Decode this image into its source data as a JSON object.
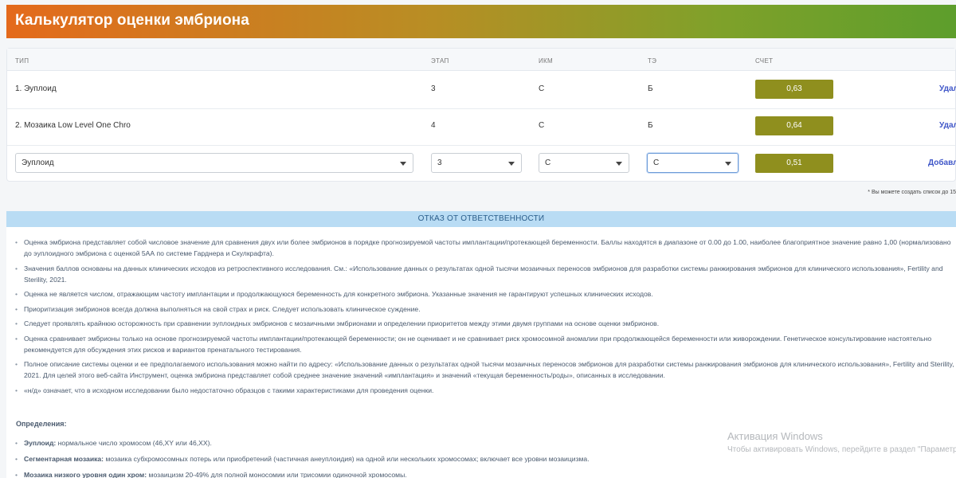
{
  "header": {
    "title": "Калькулятор оценки эмбриона"
  },
  "table": {
    "columns": [
      "ТИП",
      "ЭТАП",
      "ИКМ",
      "ТЭ",
      "СЧЕТ"
    ],
    "rows": [
      {
        "type": "1. Эуплоид",
        "stage": "3",
        "icm": "C",
        "te": "Б",
        "score": "0,63",
        "action": "Удал"
      },
      {
        "type": "2. Мозаика Low Level One Chro",
        "stage": "4",
        "icm": "C",
        "te": "Б",
        "score": "0,64",
        "action": "Удал"
      }
    ],
    "input_row": {
      "type": "Эуплоид",
      "stage": "3",
      "icm": "C",
      "te": "C",
      "score": "0,51",
      "action": "Добавл"
    }
  },
  "note": "* Вы можете создать список до 15",
  "disclaimer": {
    "title": "ОТКАЗ ОТ ОТВЕТСТВЕННОСТИ",
    "items": [
      "Оценка эмбриона представляет собой числовое значение для сравнения двух или более эмбрионов в порядке прогнозируемой частоты имплантации/протекающей беременности. Баллы находятся в диапазоне от 0.00 до 1.00, наиболее благоприятное значение равно 1,00 (нормализовано до эуплоидного эмбриона с оценкой 5АА по системе Гарднера и Скулкрафта).",
      "Значения баллов основаны на данных клинических исходов из ретроспективного исследования. См.: «Использование данных о результатах одной тысячи мозаичных переносов эмбрионов для разработки системы ранжирования эмбрионов для клинического использования», Fertility and Sterility, 2021.",
      "Оценка не является числом, отражающим частоту имплантации и продолжающуюся беременность для конкретного эмбриона. Указанные значения не гарантируют успешных клинических исходов.",
      "Приоритизация эмбрионов всегда должна выполняться на свой страх и риск. Следует использовать клиническое суждение.",
      "Следует проявлять крайнюю осторожность при сравнении эуплоидных эмбрионов с мозаичными эмбрионами и определении приоритетов между этими двумя группами на основе оценки эмбрионов.",
      "Оценка сравнивает эмбрионы только на основе прогнозируемой частоты имплантации/протекающей беременности; он не оценивает и не сравнивает риск хромосомной аномалии при продолжающейся беременности или живорождении. Генетическое консультирование настоятельно рекомендуется для обсуждения этих рисков и вариантов пренатального тестирования.",
      "Полное описание системы оценки и ее предполагаемого использования можно найти по адресу: «Использование данных о результатах одной тысячи мозаичных переносов эмбрионов для разработки системы ранжирования эмбрионов для клинического использования», Fertility and Sterility, 2021. Для целей этого веб-сайта Инструмент, оценка эмбриона представляет собой среднее значение значений «имплантация» и значений «текущая беременность/роды», описанных в исследовании.",
      "«н/д» означает, что в исходном исследовании было недостаточно образцов с такими характеристиками для проведения оценки."
    ],
    "definitions_title": "Определения:",
    "definitions": [
      {
        "term": "Эуплоид:",
        "text": "нормальное число хромосом (46,XY или 46,XX)."
      },
      {
        "term": "Сегментарная мозаика:",
        "text": "мозаика субхромосомных потерь или приобретений (частичная анеуплоидия) на одной или нескольких хромосомах; включает все уровни мозаицизма."
      },
      {
        "term": "Мозаика низкого уровня один хром:",
        "text": "мозаицизм 20-49% для полной моносомии или трисомии одиночной хромосомы."
      }
    ]
  },
  "watermark": {
    "line1": "Активация Windows",
    "line2": "Чтобы активировать Windows, перейдите в раздел \"Параметр"
  }
}
